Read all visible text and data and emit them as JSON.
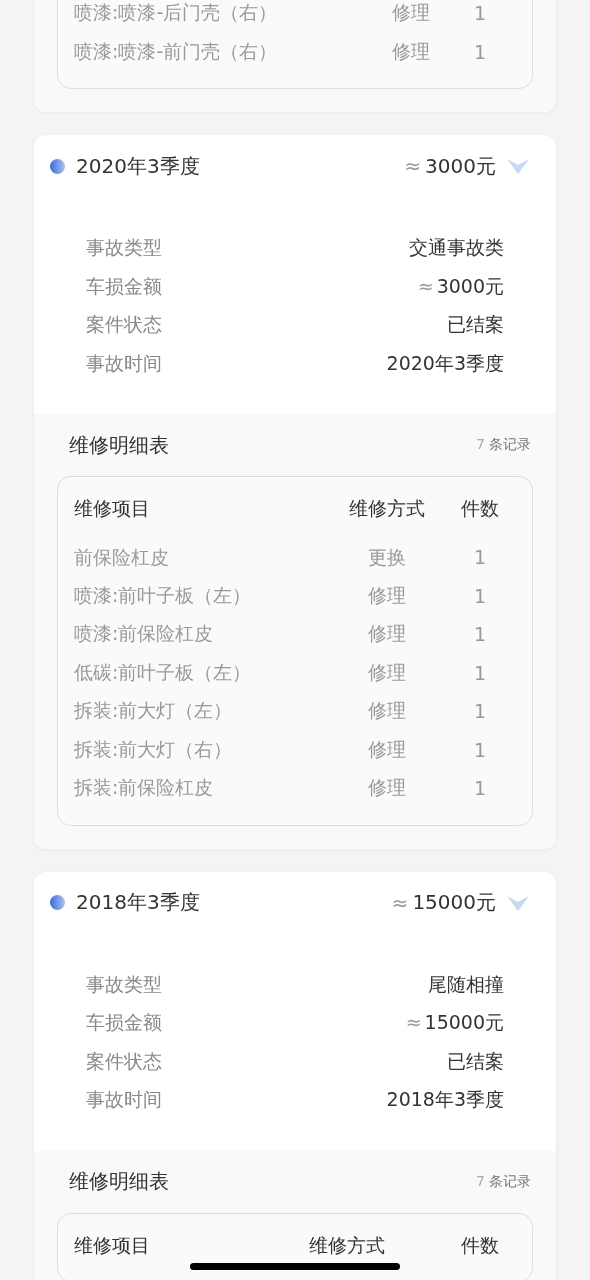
{
  "cards": [
    {
      "details": {
        "rows": [
          {
            "item": "喷漆:喷漆-后门壳（右）",
            "method": "修理",
            "count": "1"
          },
          {
            "item": "喷漆:喷漆-前门壳（右）",
            "method": "修理",
            "count": "1"
          }
        ]
      }
    },
    {
      "header": {
        "title": "2020年3季度",
        "approx": "≈",
        "amount": "3000元",
        "expanded": true
      },
      "info": [
        {
          "label": "事故类型",
          "value": "交通事故类"
        },
        {
          "label": "车损金额",
          "prefix": "≈",
          "value": "3000元"
        },
        {
          "label": "案件状态",
          "value": "已结案"
        },
        {
          "label": "事故时间",
          "value": "2020年3季度"
        }
      ],
      "details": {
        "title": "维修明细表",
        "record_count": "7",
        "record_unit": "条记录",
        "columns": [
          "维修项目",
          "维修方式",
          "件数"
        ],
        "rows": [
          {
            "item": "前保险杠皮",
            "method": "更换",
            "count": "1"
          },
          {
            "item": "喷漆:前叶子板（左）",
            "method": "修理",
            "count": "1"
          },
          {
            "item": "喷漆:前保险杠皮",
            "method": "修理",
            "count": "1"
          },
          {
            "item": "低碳:前叶子板（左）",
            "method": "修理",
            "count": "1"
          },
          {
            "item": "拆装:前大灯（左）",
            "method": "修理",
            "count": "1"
          },
          {
            "item": "拆装:前大灯（右）",
            "method": "修理",
            "count": "1"
          },
          {
            "item": "拆装:前保险杠皮",
            "method": "修理",
            "count": "1"
          }
        ]
      }
    },
    {
      "header": {
        "title": "2018年3季度",
        "approx": "≈",
        "amount": "15000元",
        "expanded": true
      },
      "info": [
        {
          "label": "事故类型",
          "value": "尾随相撞"
        },
        {
          "label": "车损金额",
          "prefix": "≈",
          "value": "15000元"
        },
        {
          "label": "案件状态",
          "value": "已结案"
        },
        {
          "label": "事故时间",
          "value": "2018年3季度"
        }
      ],
      "details": {
        "title": "维修明细表",
        "record_count": "7",
        "record_unit": "条记录",
        "columns": [
          "维修项目",
          "维修方式",
          "件数"
        ]
      }
    }
  ]
}
